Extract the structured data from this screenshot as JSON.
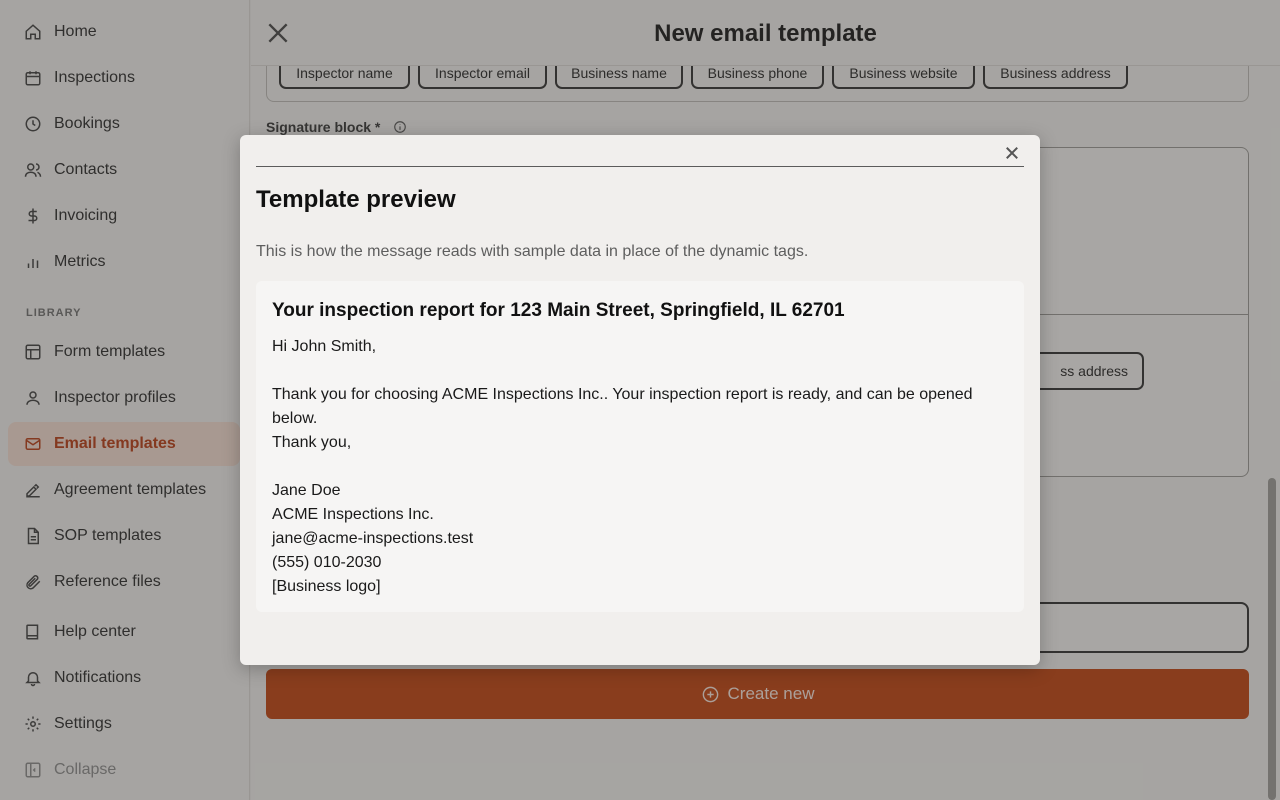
{
  "sidebar": {
    "items": [
      {
        "label": "Home",
        "icon": "home-icon"
      },
      {
        "label": "Inspections",
        "icon": "calendar-icon"
      },
      {
        "label": "Bookings",
        "icon": "clock-icon"
      },
      {
        "label": "Contacts",
        "icon": "users-icon"
      },
      {
        "label": "Invoicing",
        "icon": "dollar-icon"
      },
      {
        "label": "Metrics",
        "icon": "bar-chart-icon"
      }
    ],
    "section_label": "LIBRARY",
    "library_items": [
      {
        "label": "Form templates",
        "icon": "layout-icon"
      },
      {
        "label": "Inspector profiles",
        "icon": "user-icon"
      },
      {
        "label": "Email templates",
        "icon": "mail-icon",
        "active": true
      },
      {
        "label": "Agreement templates",
        "icon": "signature-icon"
      },
      {
        "label": "SOP templates",
        "icon": "document-icon"
      },
      {
        "label": "Reference files",
        "icon": "paperclip-icon"
      }
    ],
    "footer_items": [
      {
        "label": "Help center",
        "icon": "book-icon"
      },
      {
        "label": "Notifications",
        "icon": "bell-icon"
      },
      {
        "label": "Settings",
        "icon": "gear-icon"
      },
      {
        "label": "Collapse",
        "icon": "sidebar-collapse-icon"
      }
    ]
  },
  "editor": {
    "title": "New email template",
    "tags": [
      "Inspector name",
      "Inspector email",
      "Business name",
      "Business phone",
      "Business website",
      "Business address"
    ],
    "signature_label": "Signature block *",
    "editor_chip_partial": "ss address",
    "create_button": "Create new"
  },
  "modal": {
    "title": "Template preview",
    "description": "This is how the message reads with sample data in place of the dynamic tags.",
    "subject": "Your inspection report for 123 Main Street, Springfield, IL 62701",
    "body_lines": [
      "Hi John Smith,",
      "",
      "Thank you for choosing ACME Inspections Inc.. Your inspection report is ready, and can be opened below.",
      "Thank you,",
      "",
      "Jane Doe",
      "ACME Inspections Inc.",
      "jane@acme-inspections.test",
      "(555) 010-2030",
      "[Business logo]"
    ]
  },
  "colors": {
    "accent": "#c2410c",
    "active_nav_bg": "#f6ded3",
    "active_nav_text": "#b83a10"
  }
}
